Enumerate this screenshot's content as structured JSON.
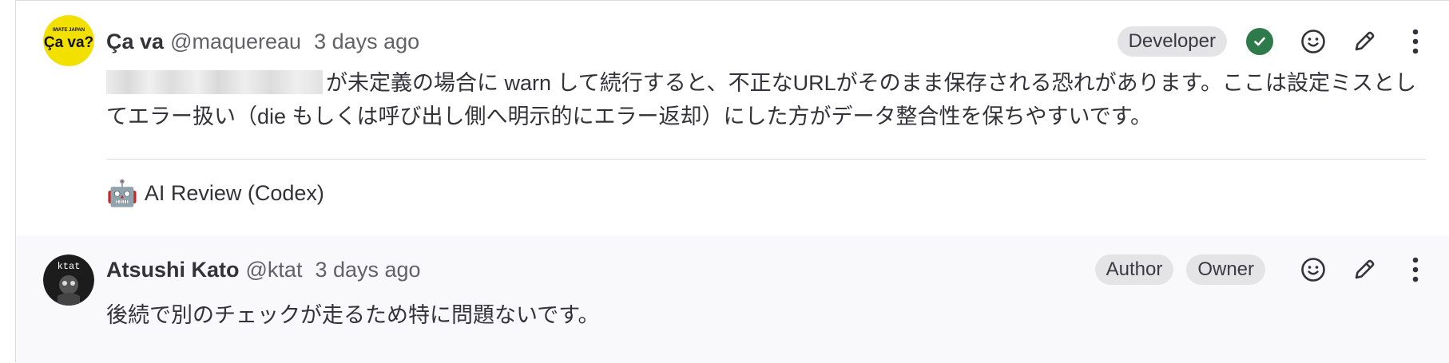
{
  "notes": [
    {
      "author": "Ça va",
      "username": "@maquereau",
      "time": "3 days ago",
      "roles": [
        "Developer"
      ],
      "resolved": true,
      "avatar_text_top": "IWATE JAPAN",
      "avatar_text": "Ça va?",
      "avatar_color": "#f2e000",
      "body_blurred": "(redacted)",
      "body": "が未定義の場合に warn して続行すると、不正なURLがそのまま保存される恐れがあります。ここは設定ミスとしてエラー扱い（die もしくは呼び出し側へ明示的にエラー返却）にした方がデータ整合性を保ちやすいです。",
      "footer": "AI Review (Codex)",
      "footer_icon": "robot-icon",
      "icons": [
        "check-circle-icon",
        "emoji-icon",
        "pencil-icon",
        "more-vertical-icon"
      ]
    },
    {
      "author": "Atsushi Kato",
      "username": "@ktat",
      "time": "3 days ago",
      "roles": [
        "Author",
        "Owner"
      ],
      "resolved": false,
      "avatar_text": "ktat",
      "body": "後続で別のチェックが走るため特に問題ないです。",
      "icons": [
        "emoji-icon",
        "pencil-icon",
        "more-vertical-icon"
      ]
    }
  ],
  "colors": {
    "accent_resolved": "#2f7a4a",
    "badge_bg": "#e4e4e7",
    "note2_bg": "#f9f9fb"
  }
}
